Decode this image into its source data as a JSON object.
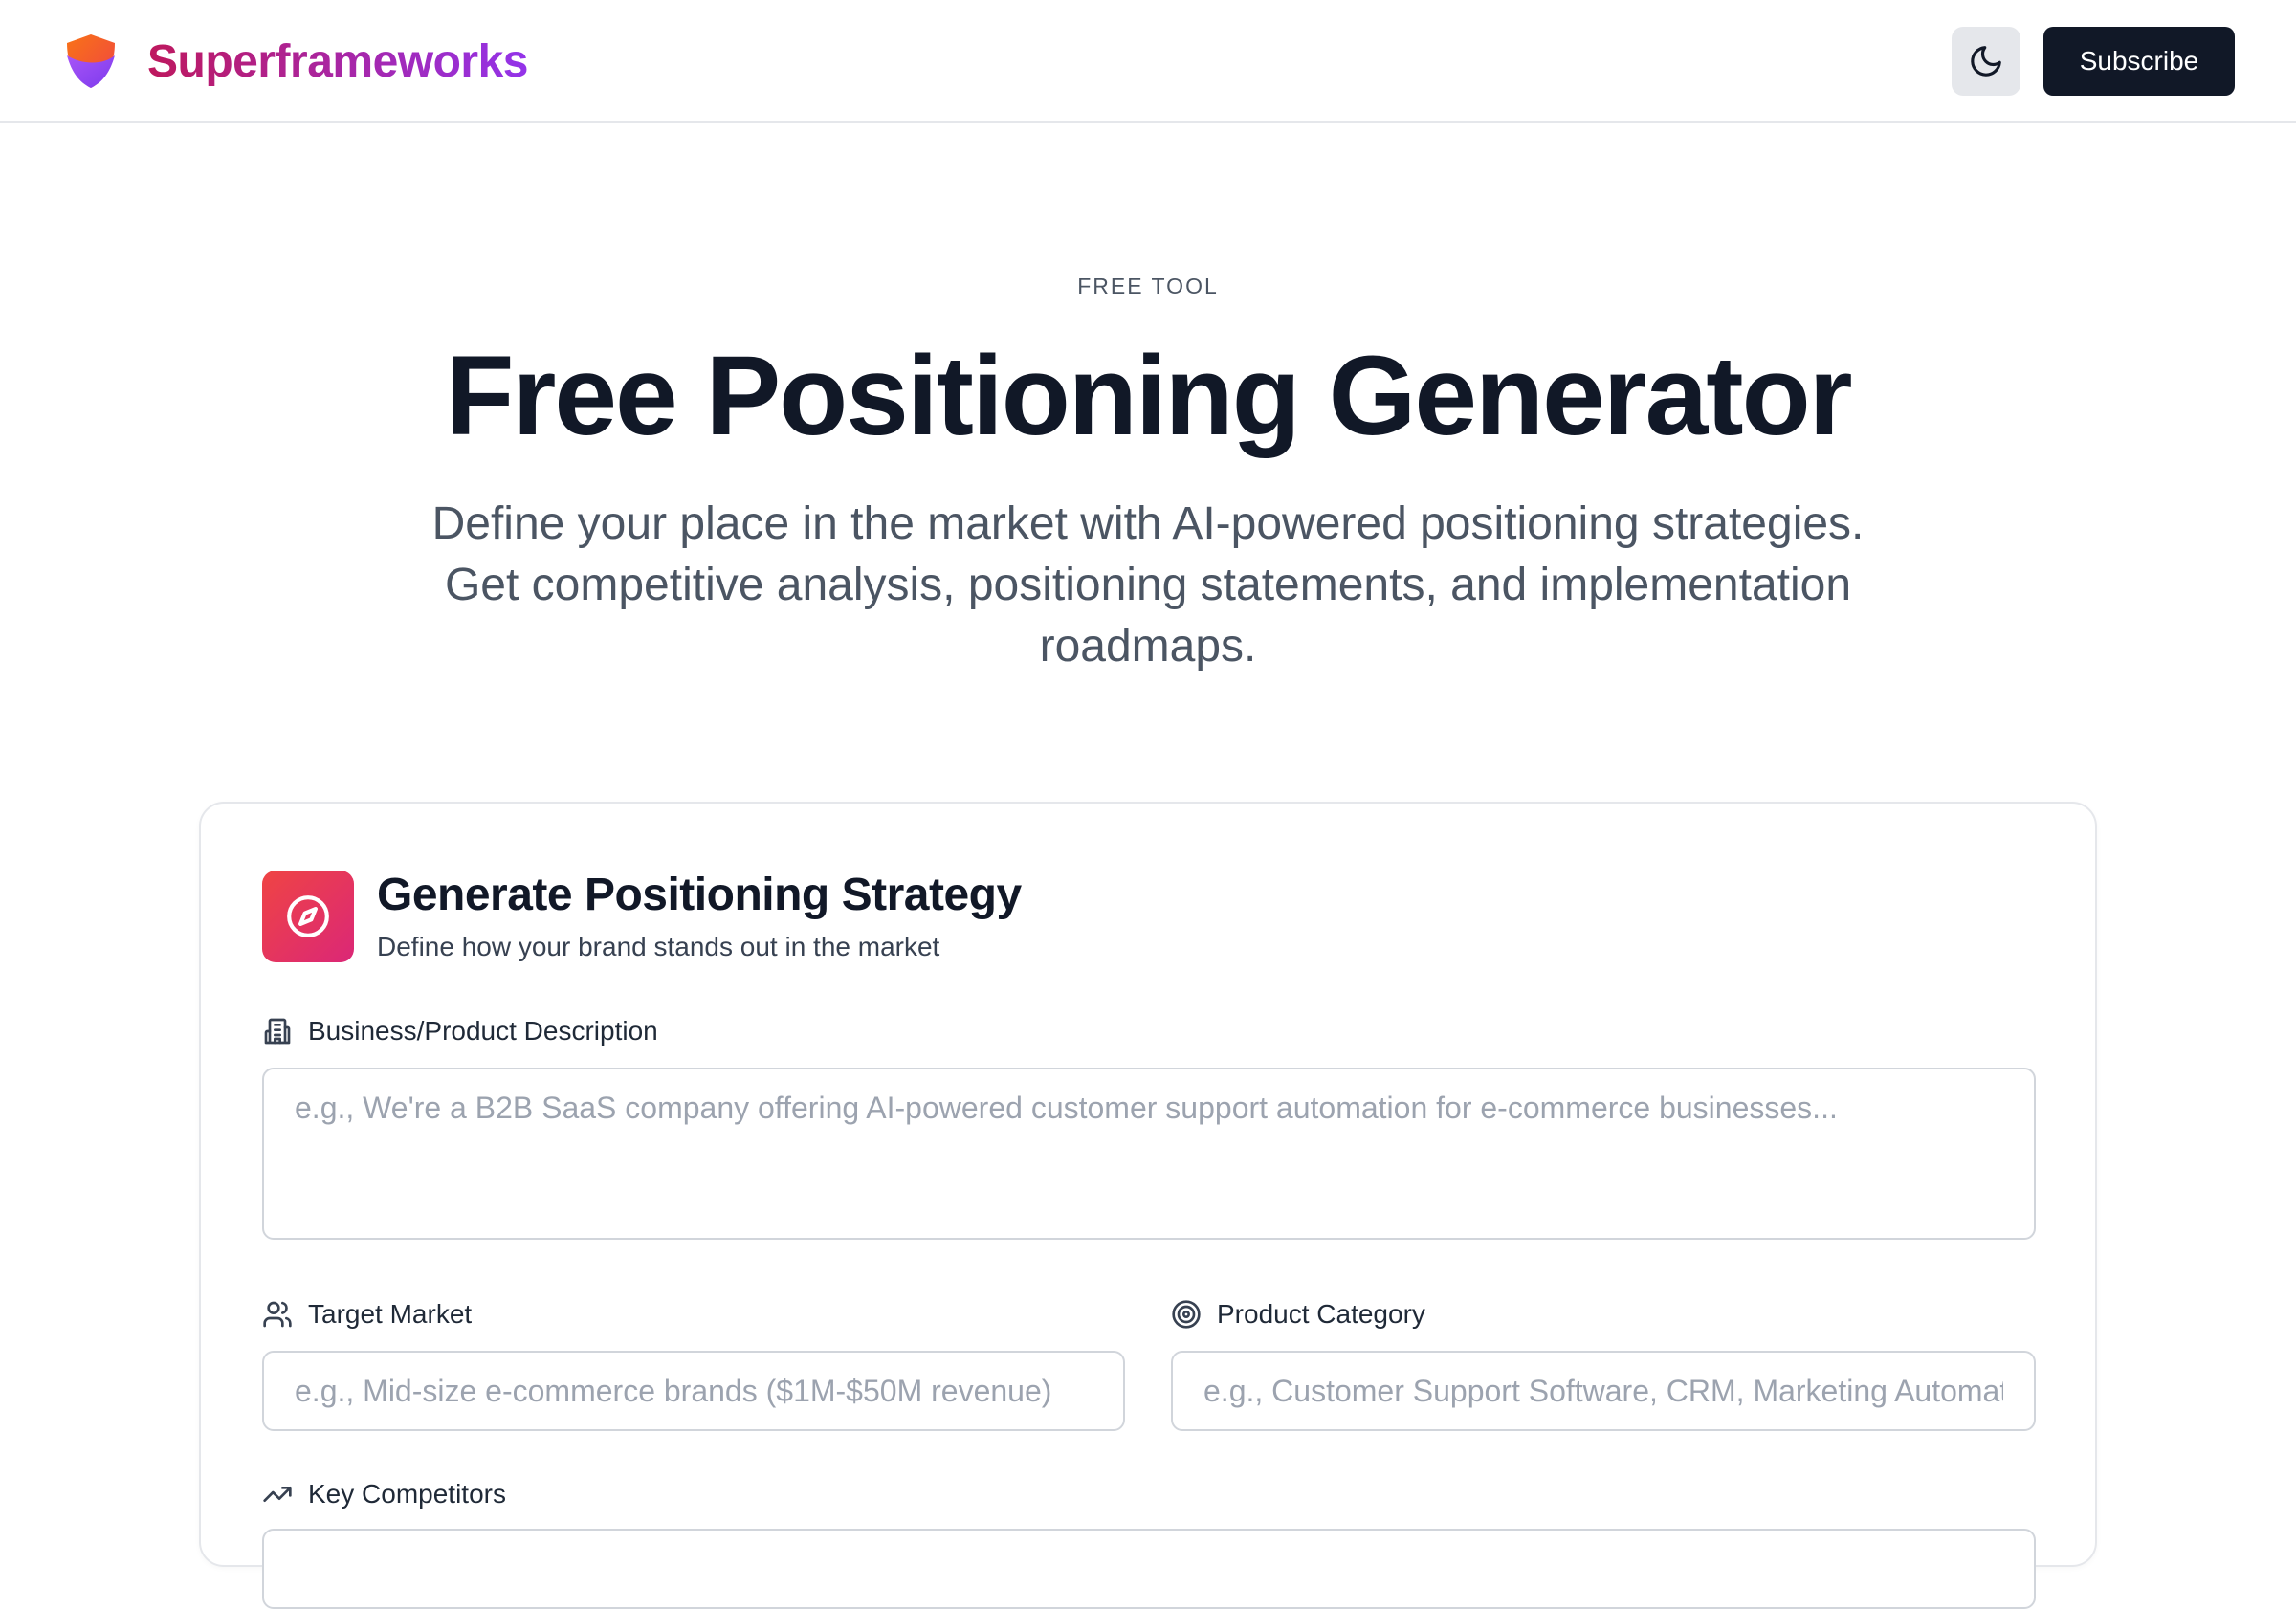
{
  "header": {
    "brand_name": "Superframeworks",
    "logo_icon": "shield-logo-icon",
    "theme_toggle_icon": "moon-icon",
    "subscribe_label": "Subscribe"
  },
  "hero": {
    "eyebrow": "FREE TOOL",
    "title": "Free Positioning Generator",
    "subtitle": "Define your place in the market with AI-powered positioning strategies. Get competitive analysis, positioning statements, and implementation roadmaps."
  },
  "form": {
    "title": "Generate Positioning Strategy",
    "description": "Define how your brand stands out in the market",
    "header_icon": "compass-icon",
    "fields": {
      "business": {
        "label": "Business/Product Description",
        "icon": "building-icon",
        "value": "",
        "placeholder": "e.g., We're a B2B SaaS company offering AI-powered customer support automation for e-commerce businesses..."
      },
      "target_market": {
        "label": "Target Market",
        "icon": "users-icon",
        "value": "",
        "placeholder": "e.g., Mid-size e-commerce brands ($1M-$50M revenue)"
      },
      "product_category": {
        "label": "Product Category",
        "icon": "target-icon",
        "value": "",
        "placeholder": "e.g., Customer Support Software, CRM, Marketing Automation"
      },
      "competitors": {
        "label": "Key Competitors",
        "icon": "trending-up-icon"
      }
    }
  },
  "colors": {
    "brand_gradient_start": "#be185d",
    "brand_gradient_end": "#9333ea",
    "primary_button": "#111827",
    "card_icon_start": "#ef4444",
    "card_icon_end": "#db2777",
    "border": "#d1d5db"
  }
}
